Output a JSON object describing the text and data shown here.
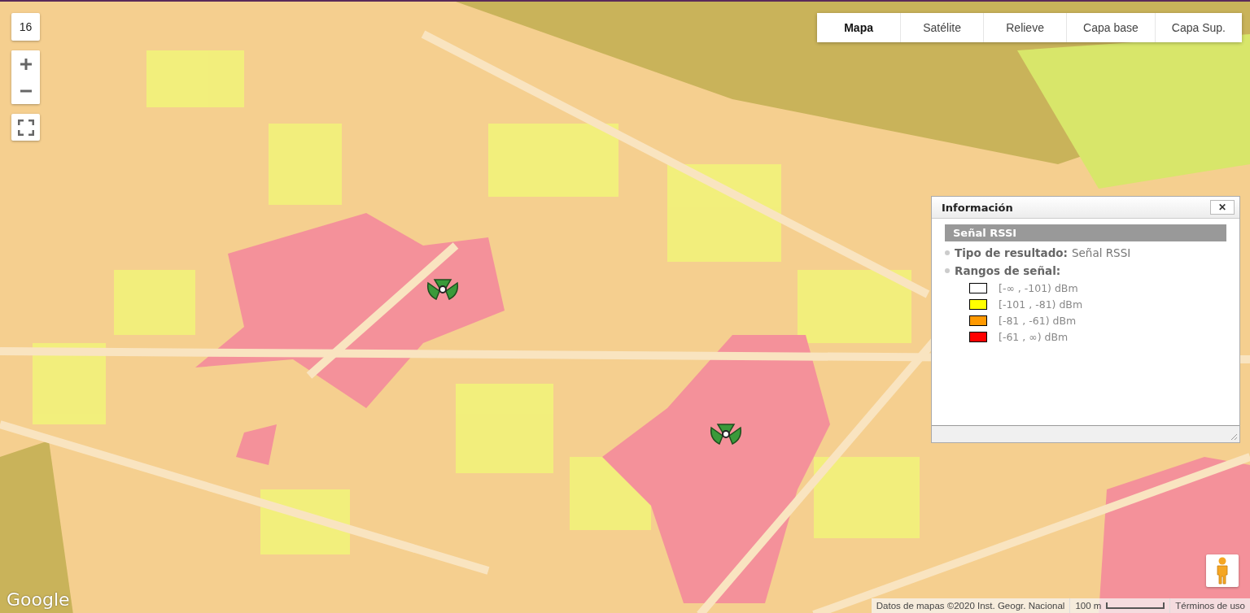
{
  "map": {
    "zoom_level": "16",
    "logo": "Google"
  },
  "map_types": [
    {
      "label": "Mapa",
      "selected": true
    },
    {
      "label": "Satélite",
      "selected": false
    },
    {
      "label": "Relieve",
      "selected": false
    },
    {
      "label": "Capa base",
      "selected": false
    },
    {
      "label": "Capa Sup.",
      "selected": false
    }
  ],
  "info_panel": {
    "title": "Información",
    "close": "✕",
    "header": "Señal RSSI",
    "fields": [
      {
        "label": "Tipo de resultado:",
        "value": "Señal RSSI"
      },
      {
        "label": "Rangos de señal:"
      }
    ],
    "ranges": [
      {
        "label": "[-∞ , -101) dBm",
        "color": "#ffffff"
      },
      {
        "label": "[-101 , -81) dBm",
        "color": "#ffff00"
      },
      {
        "label": "[-81 , -61) dBm",
        "color": "#ff9900"
      },
      {
        "label": "[-61 , ∞) dBm",
        "color": "#ff0000"
      }
    ]
  },
  "footer": {
    "attribution": "Datos de mapas ©2020 Inst. Geogr. Nacional",
    "scale": "100 m",
    "terms": "Términos de uso"
  }
}
